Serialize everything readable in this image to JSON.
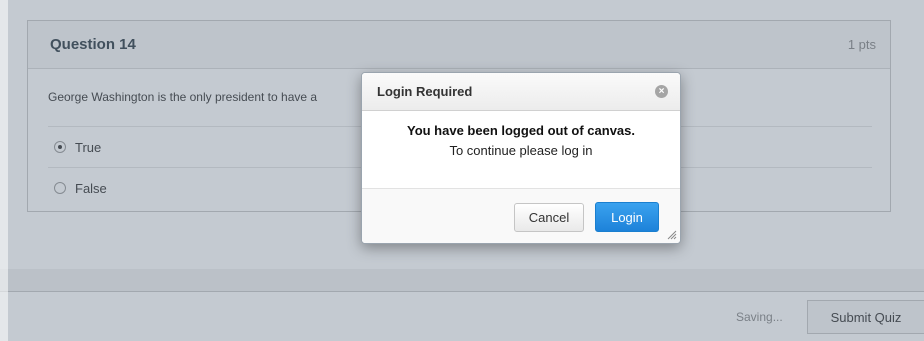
{
  "question": {
    "title": "Question 14",
    "points": "1 pts",
    "text": "George Washington is the only president to have a",
    "answers": [
      {
        "label": "True",
        "selected": true
      },
      {
        "label": "False",
        "selected": false
      }
    ]
  },
  "footer": {
    "status": "Saving...",
    "submit_label": "Submit Quiz"
  },
  "dialog": {
    "title": "Login Required",
    "message_strong": "You have been logged out of canvas.",
    "message": "To continue please log in",
    "cancel_label": "Cancel",
    "login_label": "Login",
    "close_icon": "close-icon",
    "resize_icon": "resize-handle-icon"
  },
  "colors": {
    "overlay": "#6473877a",
    "login_button": "#1d82d9",
    "title_text": "#2d3b45"
  }
}
